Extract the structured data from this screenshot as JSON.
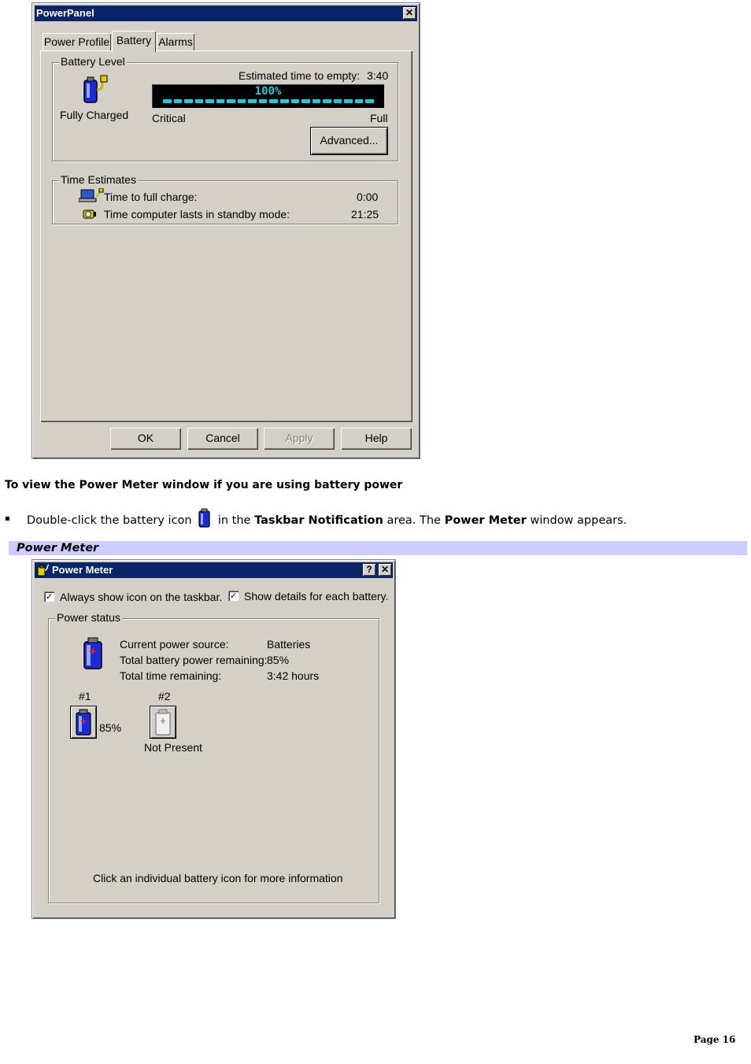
{
  "powerpanel": {
    "title": "PowerPanel",
    "close_glyph": "✕",
    "tabs": [
      {
        "label": "Power Profile"
      },
      {
        "label": "Battery"
      },
      {
        "label": "Alarms"
      }
    ],
    "battery_level": {
      "group_label": "Battery Level",
      "status_label": "Fully Charged",
      "estimated_label": "Estimated time to empty:",
      "estimated_value": "3:40",
      "percent_text": "100%",
      "level_fraction": 1.0,
      "min_label": "Critical",
      "max_label": "Full",
      "advanced_button": "Advanced..."
    },
    "time_estimates": {
      "group_label": "Time Estimates",
      "rows": [
        {
          "label": "Time to full charge:",
          "value": "0:00",
          "icon": "laptop-plug-icon"
        },
        {
          "label": "Time computer lasts in standby mode:",
          "value": "21:25",
          "icon": "standby-battery-icon"
        }
      ]
    },
    "buttons": {
      "ok": "OK",
      "cancel": "Cancel",
      "apply": "Apply",
      "help": "Help"
    }
  },
  "doc": {
    "heading": "To view the Power Meter window if you are using battery power",
    "bullet_glyph": "▪",
    "step_part1": "Double-click the battery icon",
    "step_part2": "in the",
    "step_bold1": "Taskbar Notification",
    "step_part3": "area. The",
    "step_bold2": "Power Meter",
    "step_part4": "window appears.",
    "caption": "Power Meter",
    "page_number": "Page 16"
  },
  "powermeter": {
    "title": "Power Meter",
    "help_glyph": "?",
    "close_glyph": "✕",
    "always_show_label": "Always show icon on the taskbar.",
    "show_details_label": "Show details for each battery.",
    "check_glyph": "✓",
    "group_label": "Power status",
    "rows": [
      {
        "label": "Current power source:",
        "value": "Batteries"
      },
      {
        "label": "Total battery power remaining:",
        "value": "85%"
      },
      {
        "label": "Total time remaining:",
        "value": "3:42 hours"
      }
    ],
    "battery1": {
      "number": "#1",
      "percent": "85%"
    },
    "battery2": {
      "number": "#2",
      "status": "Not Present"
    },
    "hint": "Click an individual battery icon for more information"
  },
  "colors": {
    "titlebar": "#0a246a",
    "dialog": "#d4d0c8",
    "meter_segment": "#20c8d8",
    "caption_band": "#ccccff"
  }
}
